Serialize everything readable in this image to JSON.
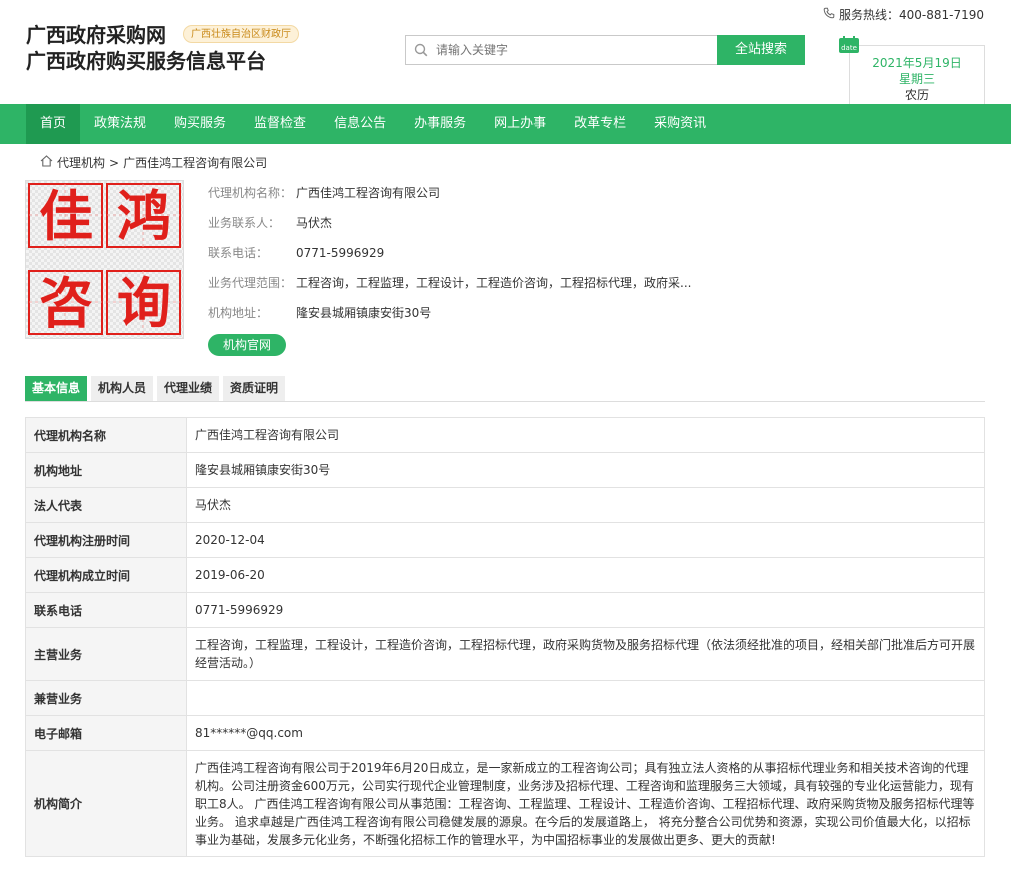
{
  "header": {
    "title_line1": "广西政府采购网",
    "title_line2": "广西政府购买服务信息平台",
    "badge": "广西壮族自治区财政厅",
    "search_placeholder": "请输入关键字",
    "search_button": "全站搜索",
    "hotline": "服务热线：400-881-7190",
    "date_icon_label": "date",
    "date": "2021年5月19日",
    "weekday": "星期三",
    "lunar": "农历"
  },
  "nav": {
    "items": [
      "首页",
      "政策法规",
      "购买服务",
      "监督检查",
      "信息公告",
      "办事服务",
      "网上办事",
      "改革专栏",
      "采购资讯"
    ]
  },
  "breadcrumb": {
    "parent": "代理机构",
    "separator": ">",
    "current": "广西佳鸿工程咨询有限公司"
  },
  "logo": {
    "chars": [
      "佳",
      "鸿",
      "咨",
      "询"
    ]
  },
  "profile": {
    "rows": [
      {
        "label": "代理机构名称：",
        "value": "广西佳鸿工程咨询有限公司"
      },
      {
        "label": "业务联系人：",
        "value": "马伏杰"
      },
      {
        "label": "联系电话：",
        "value": "0771-5996929"
      },
      {
        "label": "业务代理范围：",
        "value": "工程咨询，工程监理，工程设计，工程造价咨询，工程招标代理，政府采..."
      },
      {
        "label": "机构地址：",
        "value": "隆安县城厢镇康安街30号"
      }
    ],
    "site_button": "机构官网"
  },
  "tabs": [
    "基本信息",
    "机构人员",
    "代理业绩",
    "资质证明"
  ],
  "table": [
    {
      "k": "代理机构名称",
      "v": "广西佳鸿工程咨询有限公司"
    },
    {
      "k": "机构地址",
      "v": "隆安县城厢镇康安街30号"
    },
    {
      "k": "法人代表",
      "v": "马伏杰"
    },
    {
      "k": "代理机构注册时间",
      "v": "2020-12-04"
    },
    {
      "k": "代理机构成立时间",
      "v": "2019-06-20"
    },
    {
      "k": "联系电话",
      "v": "0771-5996929"
    },
    {
      "k": "主营业务",
      "v": "工程咨询，工程监理，工程设计，工程造价咨询，工程招标代理，政府采购货物及服务招标代理（依法须经批准的项目，经相关部门批准后方可开展经营活动。）"
    },
    {
      "k": "兼营业务",
      "v": ""
    },
    {
      "k": "电子邮箱",
      "v": "81******@qq.com"
    },
    {
      "k": "机构简介",
      "v": "广西佳鸿工程咨询有限公司于2019年6月20日成立，是一家新成立的工程咨询公司；具有独立法人资格的从事招标代理业务和相关技术咨询的代理机构。公司注册资金600万元，公司实行现代企业管理制度，业务涉及招标代理、工程咨询和监理服务三大领域，具有较强的专业化运营能力，现有职工8人。 广西佳鸿工程咨询有限公司从事范围：工程咨询、工程监理、工程设计、工程造价咨询、工程招标代理、政府采购货物及服务招标代理等业务。 追求卓越是广西佳鸿工程咨询有限公司稳健发展的源泉。在今后的发展道路上， 将充分整合公司优势和资源，实现公司价值最大化，以招标事业为基础，发展多元化业务，不断强化招标工作的管理水平，为中国招标事业的发展做出更多、更大的贡献!"
    }
  ],
  "colors": {
    "brand_green": "#2eb466",
    "nav_active": "#1f9a51",
    "logo_red": "#e0201b"
  }
}
